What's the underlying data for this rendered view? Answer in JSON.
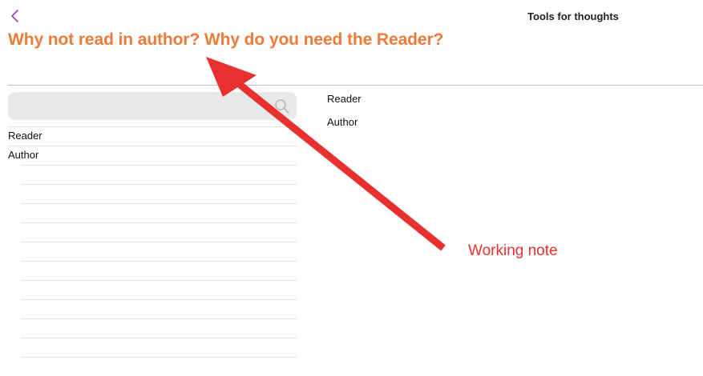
{
  "header": {
    "back_icon": "chevron-left-icon",
    "app_title": "Tools for thoughts"
  },
  "note": {
    "title": "Why not read in author? Why do you need the Reader?"
  },
  "search": {
    "placeholder": "",
    "icon": "search-icon"
  },
  "list": {
    "items": [
      {
        "label": "Reader"
      },
      {
        "label": "Author"
      }
    ],
    "empty_rows": 11
  },
  "detail": {
    "items": [
      {
        "label": "Reader"
      },
      {
        "label": "Author"
      }
    ]
  },
  "annotation": {
    "label": "Working note",
    "color": "#E8312E"
  },
  "colors": {
    "accent_title": "#EF7B3A",
    "back_icon": "#A23BC4",
    "annotation": "#E8312E"
  }
}
